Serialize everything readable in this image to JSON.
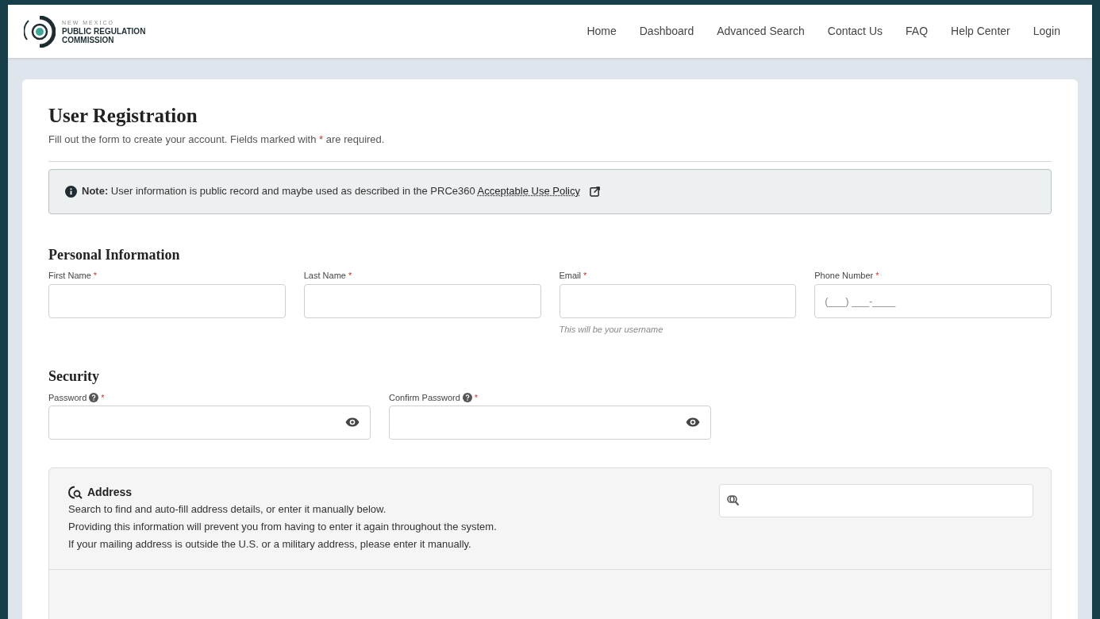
{
  "header": {
    "logo": {
      "line_1": "NEW MEXICO",
      "line_2": "PUBLIC REGULATION",
      "line_3": "COMMISSION"
    },
    "nav": [
      {
        "label": "Home"
      },
      {
        "label": "Dashboard"
      },
      {
        "label": "Advanced Search"
      },
      {
        "label": "Contact Us"
      },
      {
        "label": "FAQ"
      },
      {
        "label": "Help Center"
      },
      {
        "label": "Login"
      }
    ]
  },
  "title": "User Registration",
  "subtitle": {
    "before": "Fill out the form to create your account. Fields marked with",
    "mark": "*",
    "after": "are required."
  },
  "note": {
    "label": "Note:",
    "text": "User information is public record and maybe used as described in the PRCe360",
    "link": "Acceptable Use Policy"
  },
  "sections": [
    {
      "title": "Personal Information",
      "fields": [
        {
          "label": "First Name",
          "mark": "*",
          "help": false,
          "toggle": false
        },
        {
          "label": "Last Name",
          "mark": "*",
          "help": false,
          "toggle": false
        },
        {
          "label": "Email",
          "mark": "*",
          "help": false,
          "toggle": false,
          "hint": "This will be your username"
        },
        {
          "label": "Phone Number",
          "mark": "*",
          "help": false,
          "toggle": false,
          "placeholder": "(___) ___-____"
        }
      ]
    },
    {
      "title": "Security",
      "fields": [
        {
          "label": "Password",
          "mark": "*",
          "help": true,
          "toggle": true
        },
        {
          "label": "Confirm Password",
          "mark": "*",
          "help": true,
          "toggle": true
        }
      ]
    }
  ],
  "address": {
    "title": "Address",
    "lines": [
      "Search to find and auto-fill address details, or enter it manually below.",
      "Providing this information will prevent you from having to enter it again throughout the system.",
      "If your mailing address is outside the U.S. or a military address, please enter it manually."
    ]
  }
}
